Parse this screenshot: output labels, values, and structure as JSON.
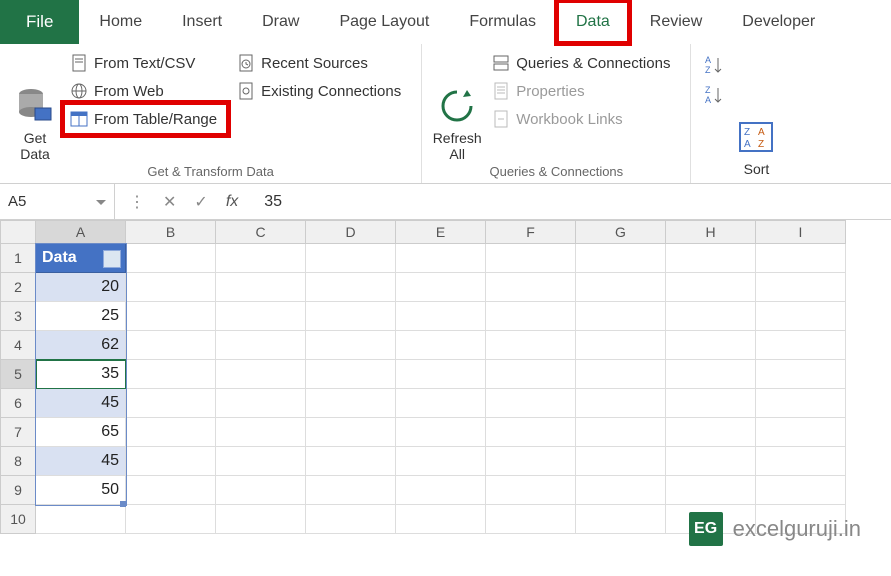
{
  "tabs": {
    "file": "File",
    "home": "Home",
    "insert": "Insert",
    "draw": "Draw",
    "page_layout": "Page Layout",
    "formulas": "Formulas",
    "data": "Data",
    "review": "Review",
    "developer": "Developer"
  },
  "ribbon": {
    "get_transform": {
      "label": "Get & Transform Data",
      "get_data": "Get\nData",
      "from_text_csv": "From Text/CSV",
      "from_web": "From Web",
      "from_table_range": "From Table/Range",
      "recent_sources": "Recent Sources",
      "existing_connections": "Existing Connections"
    },
    "queries_conn": {
      "label": "Queries & Connections",
      "refresh_all": "Refresh\nAll",
      "queries_connections": "Queries & Connections",
      "properties": "Properties",
      "workbook_links": "Workbook Links"
    },
    "sort_filter": {
      "sort": "Sort"
    }
  },
  "formula_bar": {
    "namebox": "A5",
    "value": "35"
  },
  "columns": [
    "A",
    "B",
    "C",
    "D",
    "E",
    "F",
    "G",
    "H",
    "I"
  ],
  "rows": [
    "1",
    "2",
    "3",
    "4",
    "5",
    "6",
    "7",
    "8",
    "9",
    "10"
  ],
  "table": {
    "header": "Data",
    "values": [
      "20",
      "25",
      "62",
      "35",
      "45",
      "65",
      "45",
      "50"
    ]
  },
  "selected_cell": "A5",
  "watermark": "excelguruji.in",
  "watermark_badge": "EG"
}
